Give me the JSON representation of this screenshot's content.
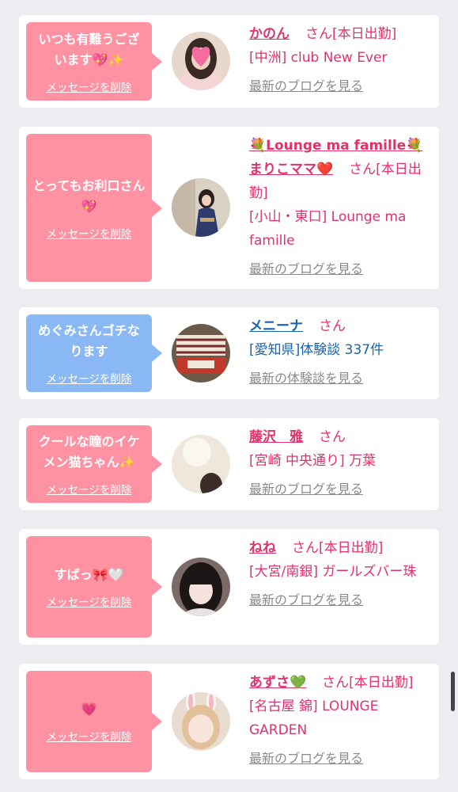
{
  "cards": [
    {
      "bubble_color": "#fe91a2",
      "message": "いつも有難うございます💖✨",
      "delete_label": "メッセージを削除",
      "name": "かのん",
      "suffix": "さん[本日出勤]",
      "shop": "[中洲] club New Ever",
      "link": "最新のブログを見る",
      "avatar_icon": "heart-sticker-girl"
    },
    {
      "bubble_color": "#fe91a2",
      "message": "とってもお利口さん💖",
      "delete_label": "メッセージを削除",
      "name": "💐Lounge ma famille💐まりこママ❤️",
      "suffix": "さん[本日出勤]",
      "shop": "[小山・東口] Lounge ma famille",
      "link": "最新のブログを見る",
      "avatar_icon": "kimono-woman"
    },
    {
      "bubble_color": "#8ab8f4",
      "message": "めぐみさんゴチなります",
      "delete_label": "メッセージを削除",
      "name": "メニーナ",
      "suffix": "さん",
      "shop": "[愛知県]体験談 337件",
      "link": "最新の体験談を見る",
      "avatar_icon": "shop-sign"
    },
    {
      "bubble_color": "#fe91a2",
      "message": "クールな瞳のイケメン猫ちゃん✨",
      "delete_label": "メッセージを削除",
      "name": "藤沢　雅",
      "suffix": "さん",
      "shop": "[宮崎 中央通り] 万葉",
      "link": "最新のブログを見る",
      "avatar_icon": "blurred-portrait"
    },
    {
      "bubble_color": "#fe91a2",
      "message": "すばっ🎀🤍",
      "delete_label": "メッセージを削除",
      "name": "ねね",
      "suffix": "さん[本日出勤]",
      "shop": "[大宮/南銀] ガールズバー珠",
      "link": "最新のブログを見る",
      "avatar_icon": "dark-hair-girl"
    },
    {
      "bubble_color": "#fe91a2",
      "message": "💗",
      "delete_label": "メッセージを削除",
      "name": "あずさ💚",
      "suffix": "さん[本日出勤]",
      "shop": "[名古屋 錦] LOUNGE GARDEN",
      "link": "最新のブログを見る",
      "avatar_icon": "bunny-ears-girl"
    }
  ]
}
